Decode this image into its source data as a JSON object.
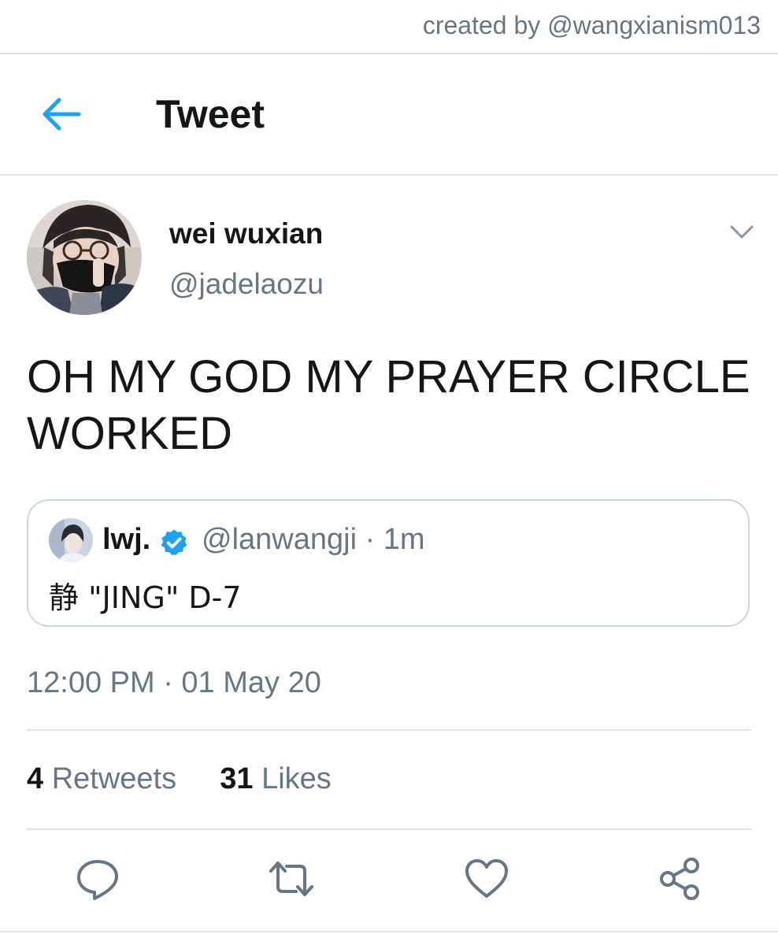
{
  "credit": "created by @wangxianism013",
  "header": {
    "title": "Tweet",
    "back_icon": "arrow-left-icon"
  },
  "author": {
    "display_name": "wei wuxian",
    "handle": "@jadelaozu",
    "menu_icon": "chevron-down-icon"
  },
  "tweet": {
    "text": "OH MY GOD MY PRAYER CIRCLE WORKED",
    "timestamp": "12:00 PM · 01 May 20"
  },
  "quoted_tweet": {
    "display_name": "lwj.",
    "verified": true,
    "handle": "@lanwangji",
    "separator": "·",
    "time": "1m",
    "text": "静 \"JING\" D-7"
  },
  "stats": {
    "retweets_count": "4",
    "retweets_label": "Retweets",
    "likes_count": "31",
    "likes_label": "Likes"
  },
  "actions": [
    "reply-icon",
    "retweet-icon",
    "like-icon",
    "share-icon"
  ],
  "colors": {
    "accent": "#1da1f2",
    "text_primary": "#14171a",
    "text_secondary": "#657786",
    "divider": "#dfe3e6",
    "icon_gray": "#657786"
  }
}
